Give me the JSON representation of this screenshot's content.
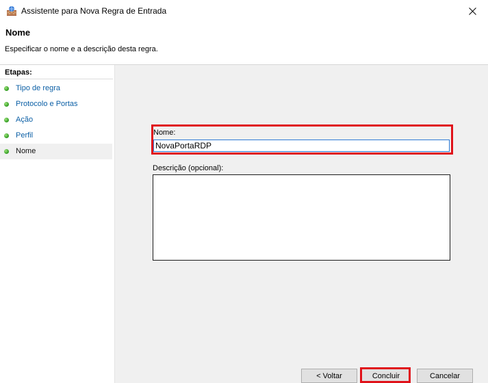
{
  "window": {
    "title": "Assistente para Nova Regra de Entrada",
    "app_icon": "firewall-icon",
    "close_icon": "close-icon"
  },
  "header": {
    "title": "Nome",
    "description": "Especificar o nome e a descrição desta regra."
  },
  "sidebar": {
    "title": "Etapas:",
    "items": [
      {
        "label": "Tipo de regra"
      },
      {
        "label": "Protocolo e Portas"
      },
      {
        "label": "Ação"
      },
      {
        "label": "Perfil"
      },
      {
        "label": "Nome",
        "current": true
      }
    ],
    "status_icon": "green-dot-icon"
  },
  "form": {
    "name_label": "Nome:",
    "name_value": "NovaPortaRDP",
    "description_label": "Descrição (opcional):",
    "description_value": ""
  },
  "buttons": {
    "back": "< Voltar",
    "finish": "Concluir",
    "cancel": "Cancelar"
  },
  "colors": {
    "highlight": "#e0121a",
    "link": "#0b5fa5",
    "content_bg": "#f0f0f0"
  }
}
